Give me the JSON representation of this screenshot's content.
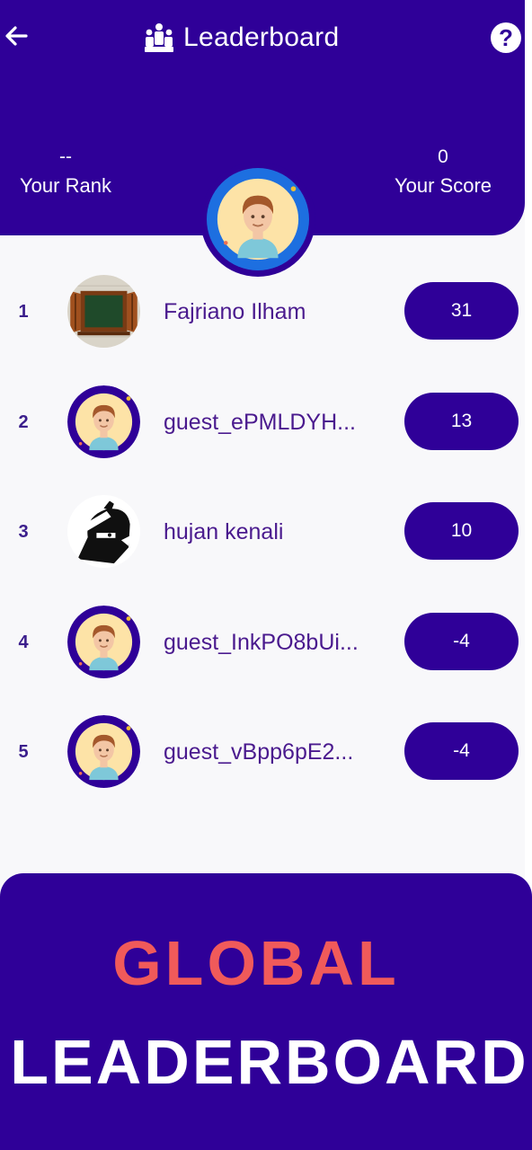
{
  "header": {
    "title": "Leaderboard",
    "back_icon": "arrow-left-icon",
    "title_icon": "group-people-icon",
    "help_label": "?",
    "help_icon": "help-circle-icon"
  },
  "stats": {
    "rank_value": "--",
    "rank_label": "Your Rank",
    "score_value": "0",
    "score_label": "Your Score"
  },
  "leaderboard": [
    {
      "rank": "1",
      "name": "Fajriano Ilham",
      "score": "31",
      "avatar": "window-avatar"
    },
    {
      "rank": "2",
      "name": "guest_ePMLDYH...",
      "score": "13",
      "avatar": "default-boy-avatar"
    },
    {
      "rank": "3",
      "name": "hujan kenali",
      "score": "10",
      "avatar": "ninja-avatar"
    },
    {
      "rank": "4",
      "name": "guest_InkPO8bUi...",
      "score": "-4",
      "avatar": "default-boy-avatar"
    },
    {
      "rank": "5",
      "name": "guest_vBpp6pE2...",
      "score": "-4",
      "avatar": "default-boy-avatar"
    }
  ],
  "banner": {
    "line1": "GLOBAL",
    "line2": "LEADERBOARD"
  },
  "colors": {
    "primary": "#2f0098",
    "accent_red": "#f05a5a",
    "rank_text": "#3b1e8c",
    "name_text": "#4a1a8e",
    "background": "#f8f8fa"
  }
}
